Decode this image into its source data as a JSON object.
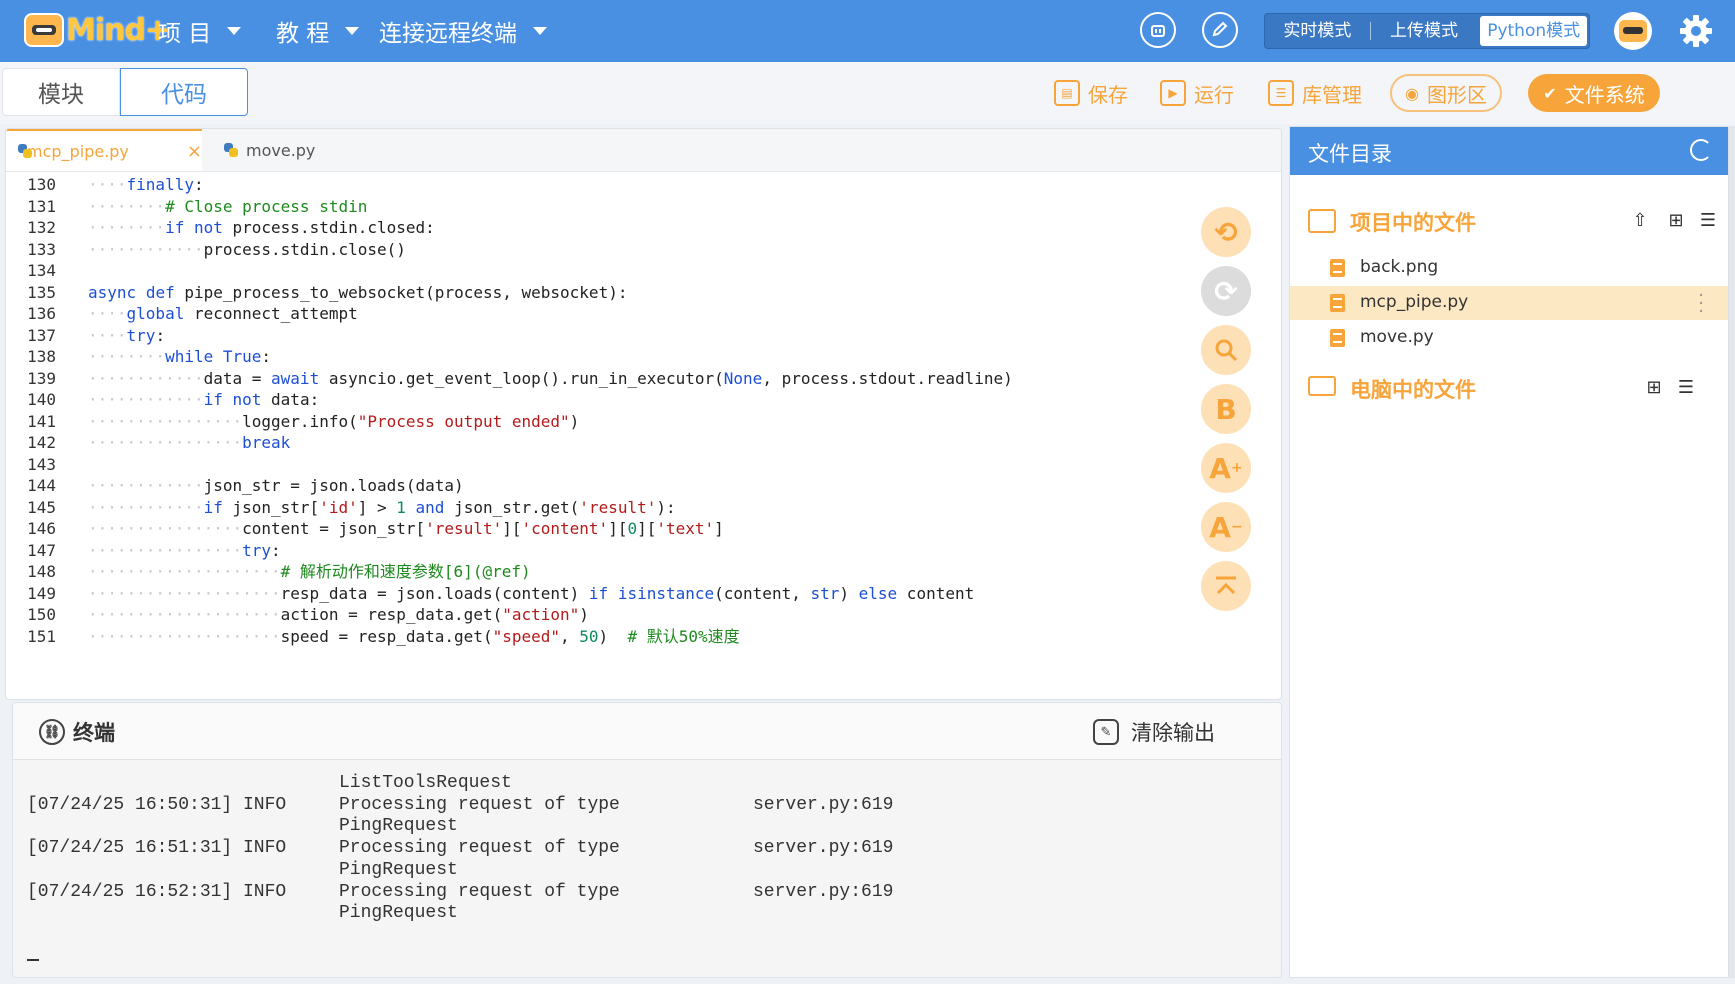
{
  "header": {
    "logo_text": "Mind+",
    "nav": [
      {
        "label": "项 目"
      },
      {
        "label": "教 程"
      },
      {
        "label": "连接远程终端"
      }
    ],
    "modes": [
      {
        "label": "实时模式",
        "active": false
      },
      {
        "label": "上传模式",
        "active": false
      },
      {
        "label": "Python模式",
        "active": true
      }
    ],
    "icons": [
      "chip-icon",
      "edit-icon",
      "avatar",
      "gear-icon"
    ],
    "accent": "#4a90e2"
  },
  "toolbar": {
    "tabs": [
      "模块",
      "代码"
    ],
    "save": "保存",
    "run": "运行",
    "library": "库管理",
    "graphics": "图形区",
    "filesystem": "文件系统",
    "accent": "#f7a43a"
  },
  "editor": {
    "tabs": [
      {
        "name": "mcp_pipe.py",
        "active": true
      },
      {
        "name": "move.py",
        "active": false
      }
    ],
    "lines": [
      {
        "n": "130",
        "code": "····finally:"
      },
      {
        "n": "131",
        "code": "········# Close process stdin"
      },
      {
        "n": "132",
        "code": "········if not process.stdin.closed:"
      },
      {
        "n": "133",
        "code": "············process.stdin.close()"
      },
      {
        "n": "134",
        "code": ""
      },
      {
        "n": "135",
        "code": "async def pipe_process_to_websocket(process, websocket):"
      },
      {
        "n": "136",
        "code": "····global reconnect_attempt"
      },
      {
        "n": "137",
        "code": "····try:"
      },
      {
        "n": "138",
        "code": "········while True:"
      },
      {
        "n": "139",
        "code": "············data = await asyncio.get_event_loop().run_in_executor(None, process.stdout.readline)"
      },
      {
        "n": "140",
        "code": "············if not data:"
      },
      {
        "n": "141",
        "code": "················logger.info(\"Process output ended\")"
      },
      {
        "n": "142",
        "code": "················break"
      },
      {
        "n": "143",
        "code": ""
      },
      {
        "n": "144",
        "code": "············json_str = json.loads(data)"
      },
      {
        "n": "145",
        "code": "············if json_str['id'] > 1 and json_str.get('result'):"
      },
      {
        "n": "146",
        "code": "················content = json_str['result']['content'][0]['text']"
      },
      {
        "n": "147",
        "code": "················try:"
      },
      {
        "n": "148",
        "code": "····················# 解析动作和速度参数[6](@ref)"
      },
      {
        "n": "149",
        "code": "····················resp_data = json.loads(content) if isinstance(content, str) else content"
      },
      {
        "n": "150",
        "code": "····················action = resp_data.get(\"action\")"
      },
      {
        "n": "151",
        "code": "····················speed = resp_data.get(\"speed\", 50)  # 默认50%速度"
      }
    ],
    "side_buttons": [
      "undo-icon",
      "redo-icon",
      "search-icon",
      "bold-icon",
      "font-increase-icon",
      "font-decrease-icon",
      "scroll-top-icon"
    ]
  },
  "terminal": {
    "title": "终端",
    "clear": "清除输出",
    "lines": [
      {
        "time": "",
        "level": "",
        "msg": "ListToolsRequest",
        "src": ""
      },
      {
        "time": "[07/24/25 16:50:31]",
        "level": "INFO",
        "msg": "Processing request of type",
        "src": "server.py:619"
      },
      {
        "time": "",
        "level": "",
        "msg": "PingRequest",
        "src": ""
      },
      {
        "time": "[07/24/25 16:51:31]",
        "level": "INFO",
        "msg": "Processing request of type",
        "src": "server.py:619"
      },
      {
        "time": "",
        "level": "",
        "msg": "PingRequest",
        "src": ""
      },
      {
        "time": "[07/24/25 16:52:31]",
        "level": "INFO",
        "msg": "Processing request of type",
        "src": "server.py:619"
      },
      {
        "time": "",
        "level": "",
        "msg": "PingRequest",
        "src": ""
      }
    ]
  },
  "filepanel": {
    "title": "文件目录",
    "project_section": "项目中的文件",
    "project_files": [
      {
        "name": "back.png",
        "selected": false
      },
      {
        "name": "mcp_pipe.py",
        "selected": true
      },
      {
        "name": "move.py",
        "selected": false
      }
    ],
    "computer_section": "电脑中的文件"
  }
}
